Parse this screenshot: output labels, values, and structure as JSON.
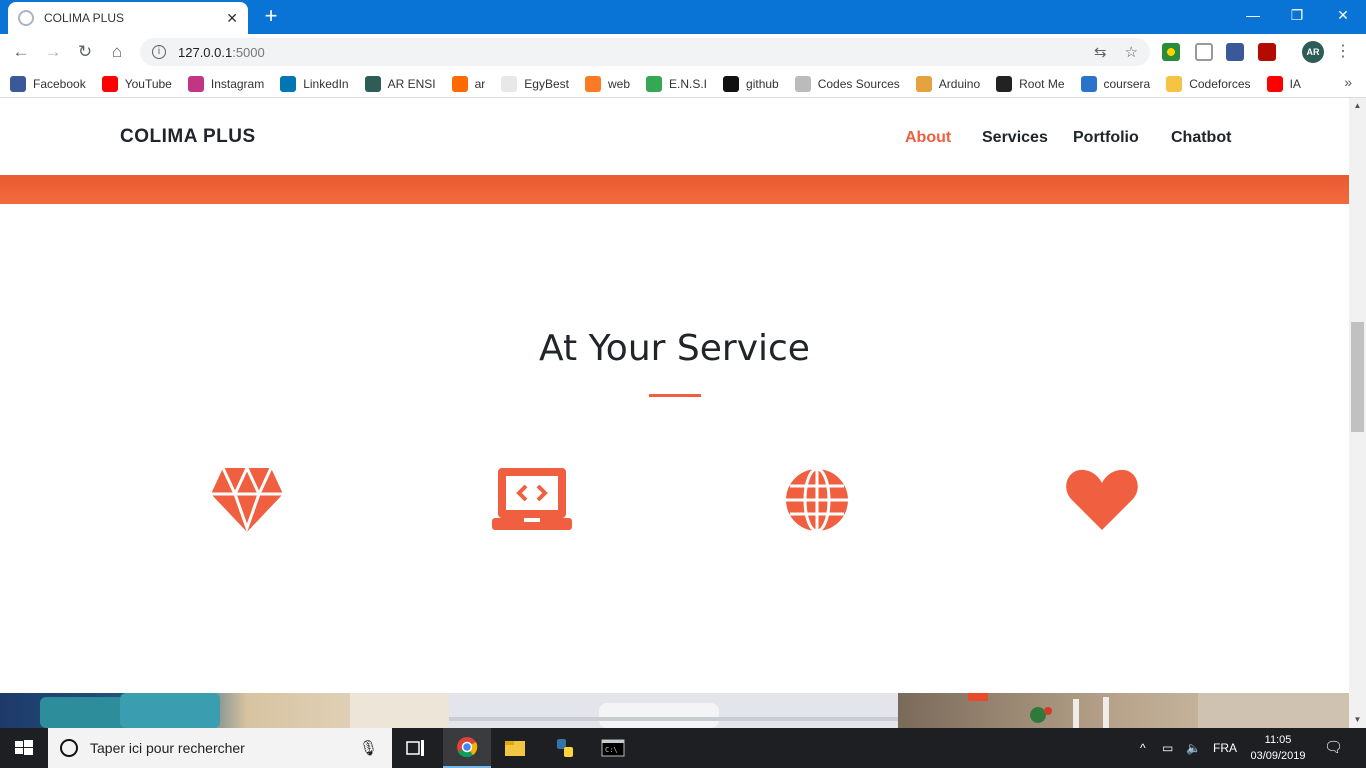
{
  "browser": {
    "tab_title": "COLIMA PLUS",
    "new_tab": "+",
    "close_tab": "✕",
    "url_host": "127.0.0.1",
    "url_port": ":5000",
    "window_controls": {
      "minimize": "—",
      "restore": "❐",
      "close": "✕"
    }
  },
  "bookmarks": [
    {
      "label": "Facebook",
      "icon": "facebook-icon",
      "color": "#3b5998"
    },
    {
      "label": "YouTube",
      "icon": "youtube-icon",
      "color": "#ff0000"
    },
    {
      "label": "Instagram",
      "icon": "instagram-icon",
      "color": "#c13584"
    },
    {
      "label": "LinkedIn",
      "icon": "linkedin-icon",
      "color": "#0077b5"
    },
    {
      "label": "AR ENSI",
      "icon": "ar-ensi-icon",
      "color": "#2e5c57"
    },
    {
      "label": "ar",
      "icon": "ar-icon",
      "color": "#ff6a00"
    },
    {
      "label": "EgyBest",
      "icon": "egybest-icon",
      "color": "#e8e8e8"
    },
    {
      "label": "web",
      "icon": "xampp-icon",
      "color": "#fb7a24"
    },
    {
      "label": "E.N.S.I",
      "icon": "drive-icon",
      "color": "#34a853"
    },
    {
      "label": "github",
      "icon": "github-icon",
      "color": "#111111"
    },
    {
      "label": "Codes Sources",
      "icon": "codes-sources-icon",
      "color": "#bbbbbb"
    },
    {
      "label": "Arduino",
      "icon": "arduino-icon",
      "color": "#e6a23c"
    },
    {
      "label": "Root Me",
      "icon": "root-me-icon",
      "color": "#222222"
    },
    {
      "label": "coursera",
      "icon": "coursera-icon",
      "color": "#2a73cc"
    },
    {
      "label": "Codeforces",
      "icon": "codeforces-icon",
      "color": "#f6c343"
    },
    {
      "label": "IA",
      "icon": "youtube-icon",
      "color": "#ff0000"
    }
  ],
  "site": {
    "brand": "COLIMA PLUS",
    "nav": [
      "About",
      "Services",
      "Portfolio",
      "Chatbot"
    ],
    "active_nav": "About",
    "accent_color": "#f05f40",
    "section_title": "At Your Service",
    "services": [
      {
        "icon": "diamond-icon"
      },
      {
        "icon": "laptop-code-icon"
      },
      {
        "icon": "globe-icon"
      },
      {
        "icon": "heart-icon"
      }
    ]
  },
  "taskbar": {
    "search_placeholder": "Taper ici pour rechercher",
    "language": "FRA",
    "time": "11:05",
    "date": "03/09/2019",
    "apps": [
      "chrome-icon",
      "file-explorer-icon",
      "python-icon",
      "terminal-icon"
    ]
  }
}
